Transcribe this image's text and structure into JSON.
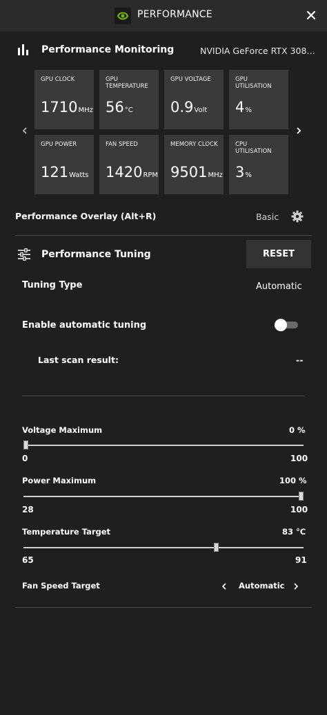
{
  "header": {
    "title": "PERFORMANCE"
  },
  "monitoring": {
    "title": "Performance Monitoring",
    "gpu_name": "NVIDIA GeForce RTX 308…",
    "tiles": [
      {
        "label": "GPU CLOCK",
        "value": "1710",
        "unit": "MHz"
      },
      {
        "label": "GPU TEMPERATURE",
        "value": "56",
        "unit": "°C"
      },
      {
        "label": "GPU VOLTAGE",
        "value": "0.9",
        "unit": "Volt"
      },
      {
        "label": "GPU UTILISATION",
        "value": "4",
        "unit": "%"
      },
      {
        "label": "GPU POWER",
        "value": "121",
        "unit": "Watts"
      },
      {
        "label": "FAN SPEED",
        "value": "1420",
        "unit": "RPM"
      },
      {
        "label": "MEMORY CLOCK",
        "value": "9501",
        "unit": "MHz"
      },
      {
        "label": "CPU UTILISATION",
        "value": "3",
        "unit": "%"
      }
    ]
  },
  "overlay": {
    "label": "Performance Overlay (Alt+R)",
    "mode": "Basic"
  },
  "tuning": {
    "title": "Performance Tuning",
    "reset_label": "RESET",
    "type_label": "Tuning Type",
    "type_value": "Automatic",
    "auto_label": "Enable automatic tuning",
    "auto_enabled": false,
    "scan_label": "Last scan result:",
    "scan_value": "--"
  },
  "sliders": {
    "voltage": {
      "label": "Voltage Maximum",
      "value_text": "0 %",
      "min": "0",
      "max": "100",
      "level": 0.0
    },
    "power": {
      "label": "Power Maximum",
      "value_text": "100 %",
      "min": "28",
      "max": "100",
      "level": 1.0
    },
    "temperature": {
      "label": "Temperature Target",
      "value_text": "83 °C",
      "min": "65",
      "max": "91",
      "level": 0.692
    }
  },
  "fan_target": {
    "label": "Fan Speed Target",
    "value": "Automatic"
  }
}
